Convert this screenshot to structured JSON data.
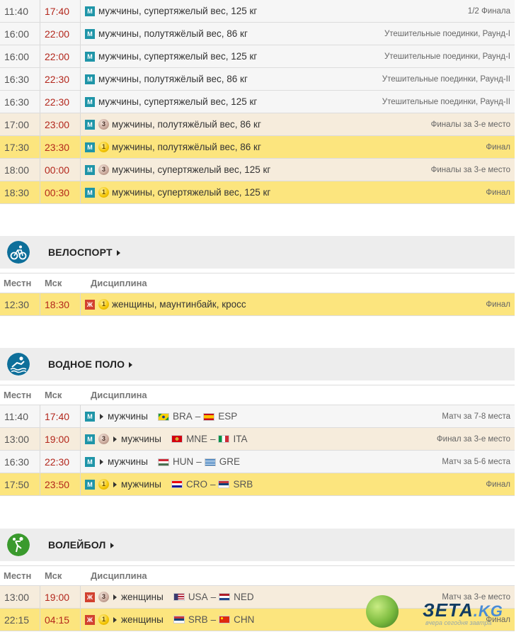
{
  "wrestling_rows": [
    {
      "loc": "11:40",
      "msk": "17:40",
      "badge": "M",
      "medal": "",
      "disc": "мужчины, супертяжелый вес, 125 кг",
      "stage": "1/2 Финала",
      "style": "plain"
    },
    {
      "loc": "16:00",
      "msk": "22:00",
      "badge": "M",
      "medal": "",
      "disc": "мужчины, полутяжёлый вес, 86 кг",
      "stage": "Утешительные поединки, Раунд-I",
      "style": "plain"
    },
    {
      "loc": "16:00",
      "msk": "22:00",
      "badge": "M",
      "medal": "",
      "disc": "мужчины, супертяжелый вес, 125 кг",
      "stage": "Утешительные поединки, Раунд-I",
      "style": "plain"
    },
    {
      "loc": "16:30",
      "msk": "22:30",
      "badge": "M",
      "medal": "",
      "disc": "мужчины, полутяжёлый вес, 86 кг",
      "stage": "Утешительные поединки, Раунд-II",
      "style": "plain"
    },
    {
      "loc": "16:30",
      "msk": "22:30",
      "badge": "M",
      "medal": "",
      "disc": "мужчины, супертяжелый вес, 125 кг",
      "stage": "Утешительные поединки, Раунд-II",
      "style": "plain"
    },
    {
      "loc": "17:00",
      "msk": "23:00",
      "badge": "M",
      "medal": "3",
      "disc": "мужчины, полутяжёлый вес, 86 кг",
      "stage": "Финалы за 3-е место",
      "style": "bronze"
    },
    {
      "loc": "17:30",
      "msk": "23:30",
      "badge": "M",
      "medal": "1",
      "disc": "мужчины, полутяжёлый вес, 86 кг",
      "stage": "Финал",
      "style": "gold"
    },
    {
      "loc": "18:00",
      "msk": "00:00",
      "badge": "M",
      "medal": "3",
      "disc": "мужчины, супертяжелый вес, 125 кг",
      "stage": "Финалы за 3-е место",
      "style": "bronze"
    },
    {
      "loc": "18:30",
      "msk": "00:30",
      "badge": "M",
      "medal": "1",
      "disc": "мужчины, супертяжелый вес, 125 кг",
      "stage": "Финал",
      "style": "gold"
    }
  ],
  "columns": {
    "loc": "Местн",
    "msk": "Мск",
    "disc": "Дисциплина"
  },
  "cycling": {
    "title": "ВЕЛОСПОРТ",
    "rows": [
      {
        "loc": "12:30",
        "msk": "18:30",
        "badge": "Ж",
        "medal": "1",
        "disc": "женщины, маунтинбайк, кросс",
        "stage": "Финал",
        "style": "gold"
      }
    ]
  },
  "waterpolo": {
    "title": "ВОДНОЕ ПОЛО",
    "rows": [
      {
        "loc": "11:40",
        "msk": "17:40",
        "badge": "M",
        "medal": "",
        "disc": "мужчины",
        "team1": "BRA",
        "team2": "ESP",
        "stage": "Матч за 7-8 места",
        "style": "plain"
      },
      {
        "loc": "13:00",
        "msk": "19:00",
        "badge": "M",
        "medal": "3",
        "disc": "мужчины",
        "team1": "MNE",
        "team2": "ITA",
        "stage": "Финал за 3-е место",
        "style": "bronze"
      },
      {
        "loc": "16:30",
        "msk": "22:30",
        "badge": "M",
        "medal": "",
        "disc": "мужчины",
        "team1": "HUN",
        "team2": "GRE",
        "stage": "Матч за 5-6 места",
        "style": "plain"
      },
      {
        "loc": "17:50",
        "msk": "23:50",
        "badge": "M",
        "medal": "1",
        "disc": "мужчины",
        "team1": "CRO",
        "team2": "SRB",
        "stage": "Финал",
        "style": "gold"
      }
    ]
  },
  "volleyball": {
    "title": "ВОЛЕЙБОЛ",
    "rows": [
      {
        "loc": "13:00",
        "msk": "19:00",
        "badge": "Ж",
        "medal": "3",
        "disc": "женщины",
        "team1": "USA",
        "team2": "NED",
        "stage": "Матч за 3-е место",
        "style": "bronze"
      },
      {
        "loc": "22:15",
        "msk": "04:15",
        "badge": "Ж",
        "medal": "1",
        "disc": "женщины",
        "team1": "SRB",
        "team2": "CHN",
        "stage": "Финал",
        "style": "gold"
      }
    ]
  },
  "watermark": {
    "brand": "ЗЕТА",
    "suffix": ".KG",
    "tagline": "вчера сегодня завтра"
  },
  "colors": {
    "gold_row": "#fce57e",
    "bronze_row": "#f6ecdc",
    "plain_row": "#f6f6f6",
    "moscow_time": "#b3271c",
    "male_badge": "#1f95a8",
    "female_badge": "#d2412f"
  }
}
